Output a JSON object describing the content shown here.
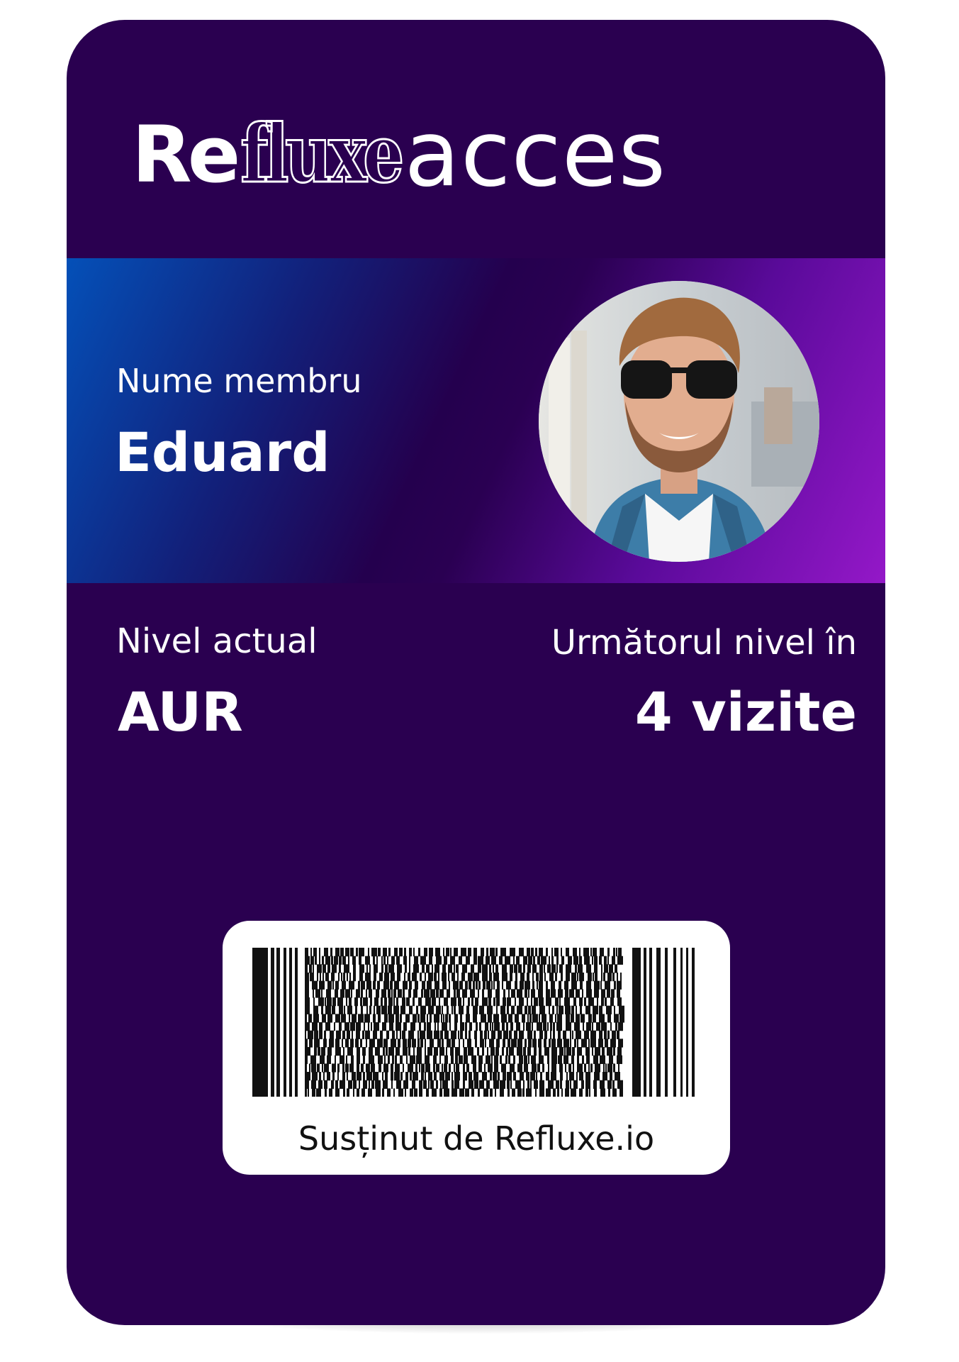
{
  "card": {
    "brand": {
      "re": "Re",
      "fluxe": "fluxe",
      "suffix": "acces"
    },
    "member": {
      "label": "Nume membru",
      "name": "Eduard",
      "avatar_icon": "member-photo"
    },
    "level": {
      "label": "Nivel actual",
      "value": "AUR"
    },
    "next_level": {
      "label": "Următorul nivel în",
      "value": "4 vizite"
    },
    "barcode": {
      "caption": "Susținut de Refluxe.io"
    }
  },
  "colors": {
    "card_background": "#2a0050",
    "band_start": "#0450b8",
    "band_mid": "#2a0052",
    "band_end": "#9418c8",
    "text": "#ffffff",
    "barcode_box": "#ffffff"
  }
}
